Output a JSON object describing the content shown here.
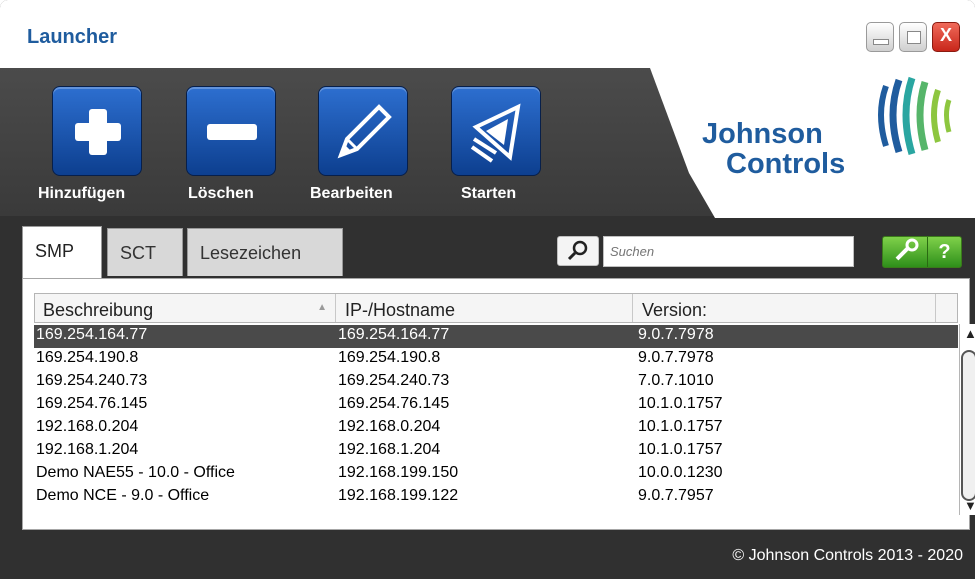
{
  "window": {
    "title": "Launcher",
    "controls": {
      "minimize": "minimize",
      "maximize": "maximize",
      "close": "X"
    }
  },
  "toolbar": {
    "buttons": [
      {
        "label": "Hinzufügen",
        "icon": "plus-icon"
      },
      {
        "label": "Löschen",
        "icon": "minus-icon"
      },
      {
        "label": "Bearbeiten",
        "icon": "pencil-icon"
      },
      {
        "label": "Starten",
        "icon": "launch-icon"
      }
    ]
  },
  "brand": {
    "line1": "Johnson",
    "line2": "Controls",
    "colors": {
      "blue": "#1f5c9e",
      "green": "#8dc63f",
      "teal": "#2aa6a1"
    }
  },
  "tabs": [
    {
      "label": "SMP",
      "active": true
    },
    {
      "label": "SCT",
      "active": false
    },
    {
      "label": "Lesezeichen",
      "active": false
    }
  ],
  "search": {
    "placeholder": "Suchen",
    "value": ""
  },
  "tools": {
    "help_label": "?"
  },
  "table": {
    "headers": [
      "Beschreibung",
      "IP-/Hostname",
      "Version:"
    ],
    "rows": [
      {
        "beschreibung": "169.254.164.77",
        "host": "169.254.164.77",
        "version": "9.0.7.7978",
        "selected": true
      },
      {
        "beschreibung": "169.254.190.8",
        "host": "169.254.190.8",
        "version": "9.0.7.7978",
        "selected": false
      },
      {
        "beschreibung": "169.254.240.73",
        "host": "169.254.240.73",
        "version": "7.0.7.1010",
        "selected": false
      },
      {
        "beschreibung": "169.254.76.145",
        "host": "169.254.76.145",
        "version": "10.1.0.1757",
        "selected": false
      },
      {
        "beschreibung": "192.168.0.204",
        "host": "192.168.0.204",
        "version": "10.1.0.1757",
        "selected": false
      },
      {
        "beschreibung": "192.168.1.204",
        "host": "192.168.1.204",
        "version": "10.1.0.1757",
        "selected": false
      },
      {
        "beschreibung": "Demo NAE55 - 10.0 - Office",
        "host": "192.168.199.150",
        "version": "10.0.0.1230",
        "selected": false
      },
      {
        "beschreibung": "Demo NCE - 9.0 - Office",
        "host": "192.168.199.122",
        "version": "9.0.7.7957",
        "selected": false
      }
    ]
  },
  "footer": {
    "copyright": "© Johnson Controls 2013 - 2020"
  }
}
